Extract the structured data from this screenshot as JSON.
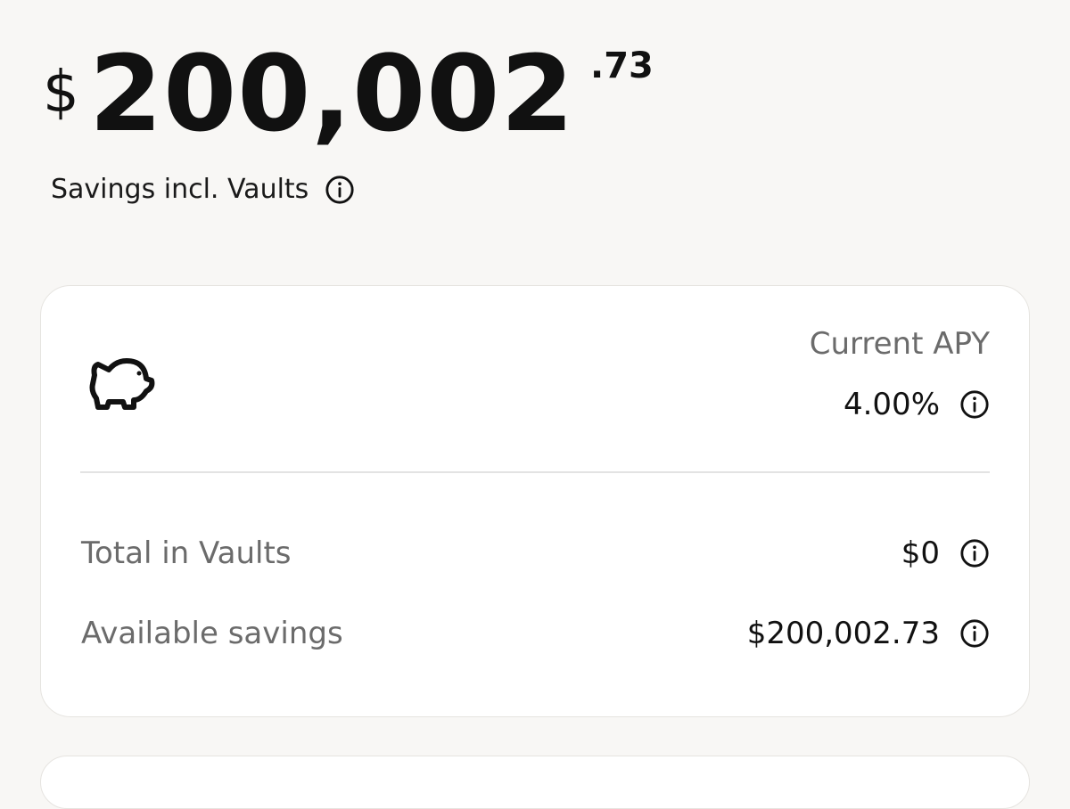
{
  "balance": {
    "currency_symbol": "$",
    "whole": "200,002",
    "cents": ".73",
    "label": "Savings incl. Vaults"
  },
  "card": {
    "apy_label": "Current APY",
    "apy_value": "4.00%",
    "rows": [
      {
        "label": "Total in Vaults",
        "value": "$0"
      },
      {
        "label": "Available savings",
        "value": "$200,002.73"
      }
    ]
  },
  "icons": {
    "info": "info-circle-icon",
    "savings": "piggy-bank-icon"
  },
  "colors": {
    "background": "#f8f7f5",
    "card": "#ffffff",
    "primary_text": "#111111",
    "secondary_text": "#6b6b6b",
    "divider": "#e3e3e3"
  }
}
